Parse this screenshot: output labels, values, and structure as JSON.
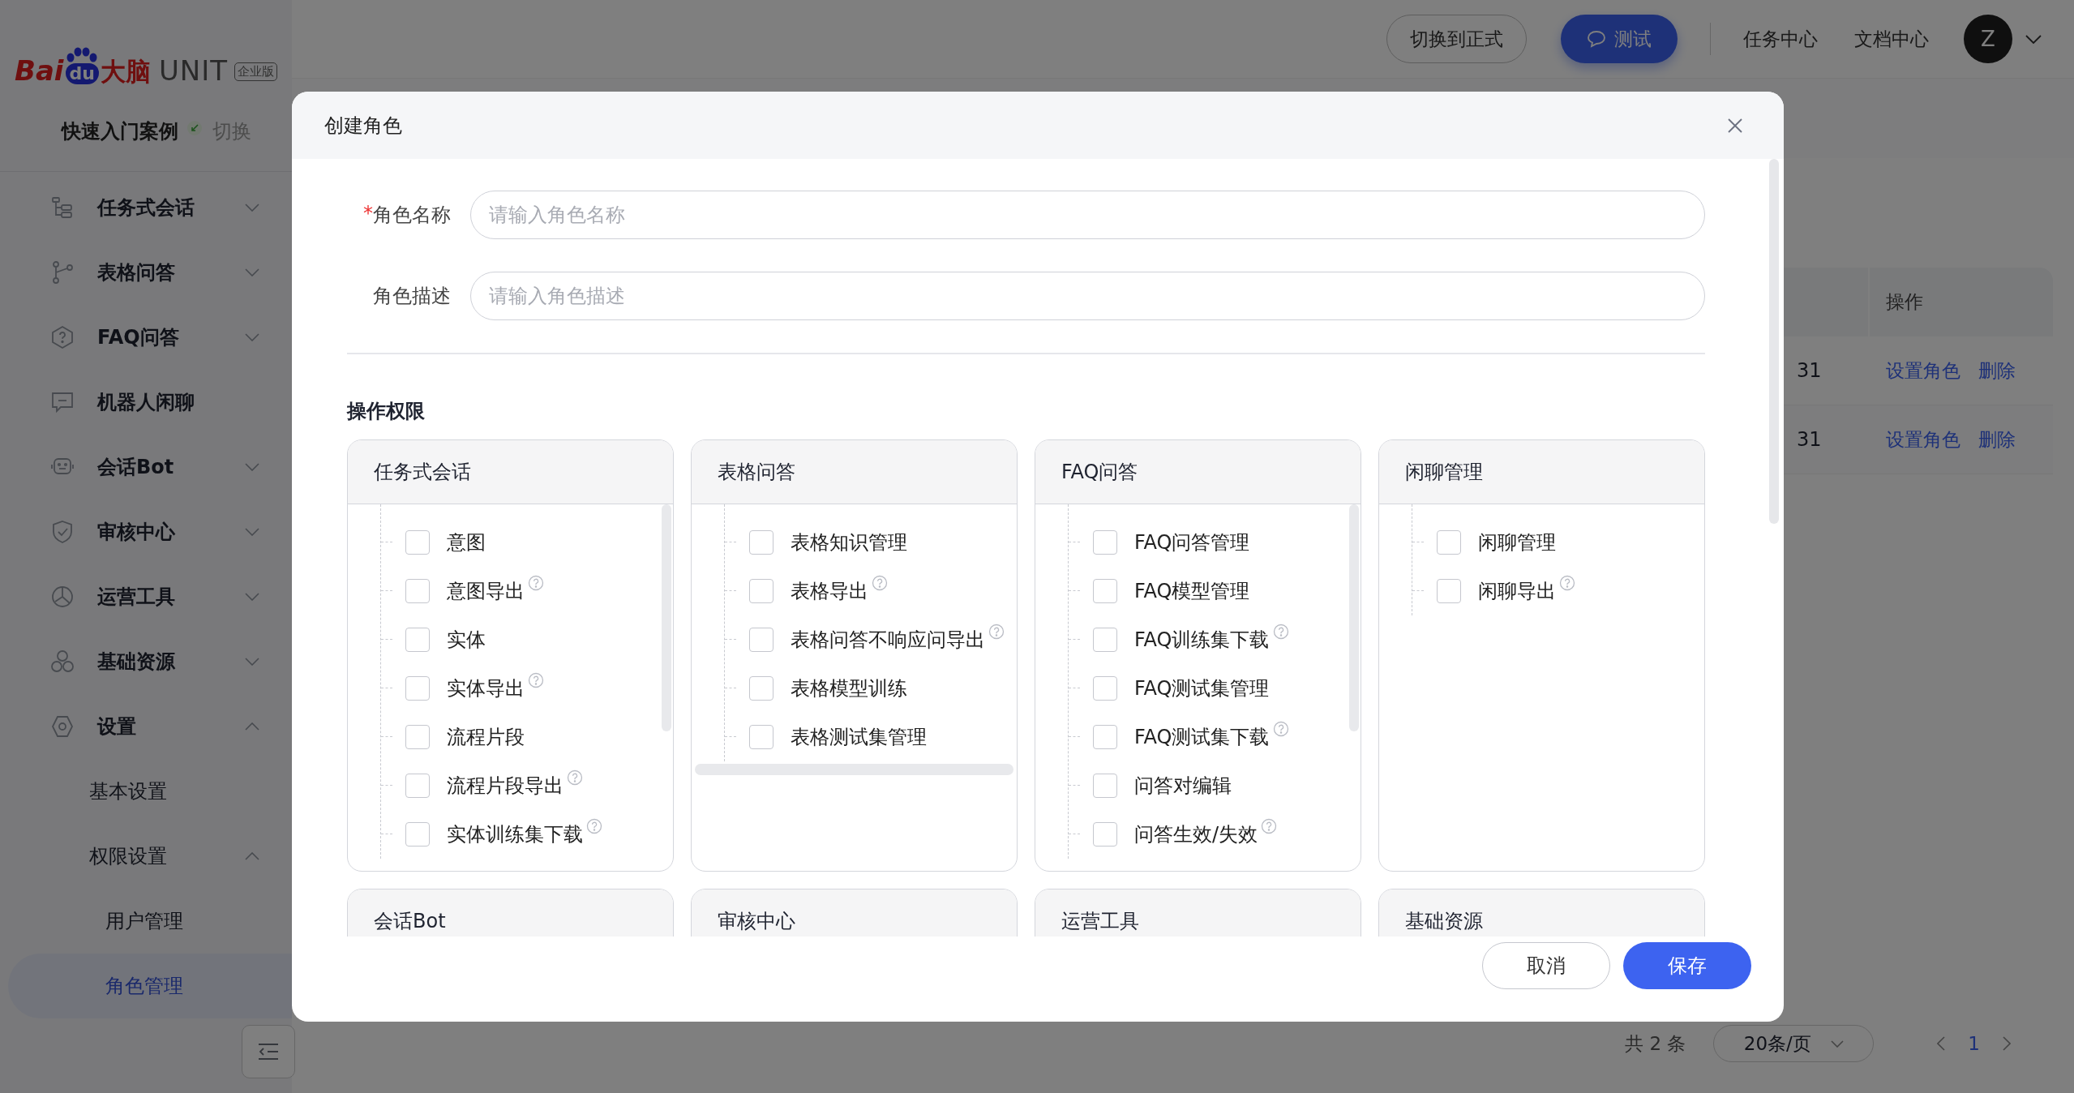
{
  "sidebar": {
    "logo": {
      "brand": "Bai",
      "mark": "du",
      "product": "大脑",
      "name": "UNIT",
      "edition": "企业版"
    },
    "quick_start": {
      "label": "快速入门案例",
      "switch": "切换"
    },
    "items": [
      {
        "label": "任务式会话",
        "expanded": false,
        "selected": false
      },
      {
        "label": "表格问答",
        "expanded": false,
        "selected": false
      },
      {
        "label": "FAQ问答",
        "expanded": false,
        "selected": false
      },
      {
        "label": "机器人闲聊",
        "selected": false
      },
      {
        "label": "会话Bot",
        "expanded": false,
        "selected": false
      },
      {
        "label": "审核中心",
        "expanded": false,
        "selected": false
      },
      {
        "label": "运营工具",
        "expanded": false,
        "selected": false
      },
      {
        "label": "基础资源",
        "expanded": false,
        "selected": false
      },
      {
        "label": "设置",
        "expanded": true,
        "selected": false,
        "children": [
          {
            "label": "基本设置",
            "selected": false
          },
          {
            "label": "权限设置",
            "expanded": true,
            "selected": false,
            "children": [
              {
                "label": "用户管理",
                "selected": false
              },
              {
                "label": "角色管理",
                "selected": true
              }
            ]
          }
        ]
      }
    ]
  },
  "topbar": {
    "switch_button": "切换到正式",
    "test_button": "测试",
    "links": [
      "任务中心",
      "文档中心"
    ],
    "avatar": "Z"
  },
  "table": {
    "columns": [
      "操作"
    ],
    "rows": [
      {
        "column_1": "31",
        "actions": [
          "设置角色",
          "删除"
        ]
      },
      {
        "column_1": "31",
        "actions": [
          "设置角色",
          "删除"
        ]
      }
    ]
  },
  "pagination": {
    "total": "共 2 条",
    "page_size": "20条/页",
    "pages": [
      {
        "label": "1",
        "selected": true
      }
    ]
  },
  "dialog": {
    "title": "创建角色",
    "fields": [
      {
        "label": "角色名称",
        "required_mark": "*",
        "placeholder": "请输入角色名称"
      },
      {
        "label": "角色描述",
        "placeholder": "请输入角色描述"
      }
    ],
    "section_title": "操作权限",
    "groups": [
      {
        "title": "任务式会话",
        "items": [
          {
            "label": "意图",
            "checked": false,
            "help": false
          },
          {
            "label": "意图导出",
            "checked": false,
            "help": true
          },
          {
            "label": "实体",
            "checked": false,
            "help": false
          },
          {
            "label": "实体导出",
            "checked": false,
            "help": true
          },
          {
            "label": "流程片段",
            "checked": false,
            "help": false
          },
          {
            "label": "流程片段导出",
            "checked": false,
            "help": true
          },
          {
            "label": "实体训练集下载",
            "checked": false,
            "help": true
          }
        ]
      },
      {
        "title": "表格问答",
        "items": [
          {
            "label": "表格知识管理",
            "checked": false,
            "help": false
          },
          {
            "label": "表格导出",
            "checked": false,
            "help": true
          },
          {
            "label": "表格问答不响应问导出",
            "checked": false,
            "help": true
          },
          {
            "label": "表格模型训练",
            "checked": false,
            "help": false
          },
          {
            "label": "表格测试集管理",
            "checked": false,
            "help": false
          }
        ]
      },
      {
        "title": "FAQ问答",
        "items": [
          {
            "label": "FAQ问答管理",
            "checked": false,
            "help": false
          },
          {
            "label": "FAQ模型管理",
            "checked": false,
            "help": false
          },
          {
            "label": "FAQ训练集下载",
            "checked": false,
            "help": true
          },
          {
            "label": "FAQ测试集管理",
            "checked": false,
            "help": false
          },
          {
            "label": "FAQ测试集下载",
            "checked": false,
            "help": true
          },
          {
            "label": "问答对编辑",
            "checked": false,
            "help": false
          },
          {
            "label": "问答生效/失效",
            "checked": false,
            "help": true
          }
        ]
      },
      {
        "title": "闲聊管理",
        "items": [
          {
            "label": "闲聊管理",
            "checked": false,
            "help": false
          },
          {
            "label": "闲聊导出",
            "checked": false,
            "help": true
          }
        ]
      },
      {
        "title": "会话Bot"
      },
      {
        "title": "审核中心"
      },
      {
        "title": "运营工具"
      },
      {
        "title": "基础资源"
      }
    ],
    "buttons": {
      "cancel": "取消",
      "save": "保存"
    }
  }
}
